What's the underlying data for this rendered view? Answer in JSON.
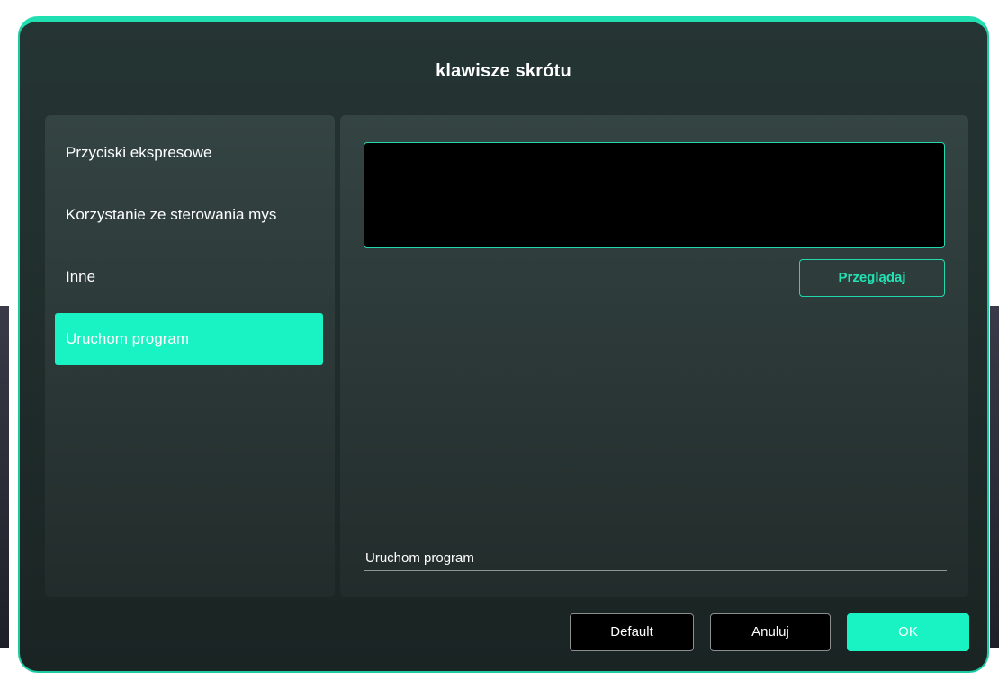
{
  "dialog": {
    "title": "klawisze skrótu"
  },
  "sidebar": {
    "items": [
      {
        "label": "Przyciski ekspresowe",
        "selected": false
      },
      {
        "label": "Korzystanie ze sterowania mys",
        "selected": false
      },
      {
        "label": "Inne",
        "selected": false
      },
      {
        "label": "Uruchom program",
        "selected": true
      }
    ]
  },
  "main": {
    "program_path_value": "",
    "browse_label": "Przeglądaj",
    "field_label": "Uruchom program"
  },
  "footer": {
    "default_label": "Default",
    "cancel_label": "Anuluj",
    "ok_label": "OK"
  },
  "colors": {
    "accent": "#19f2c2",
    "panel": "#2a3837",
    "background": "#1a2423"
  }
}
